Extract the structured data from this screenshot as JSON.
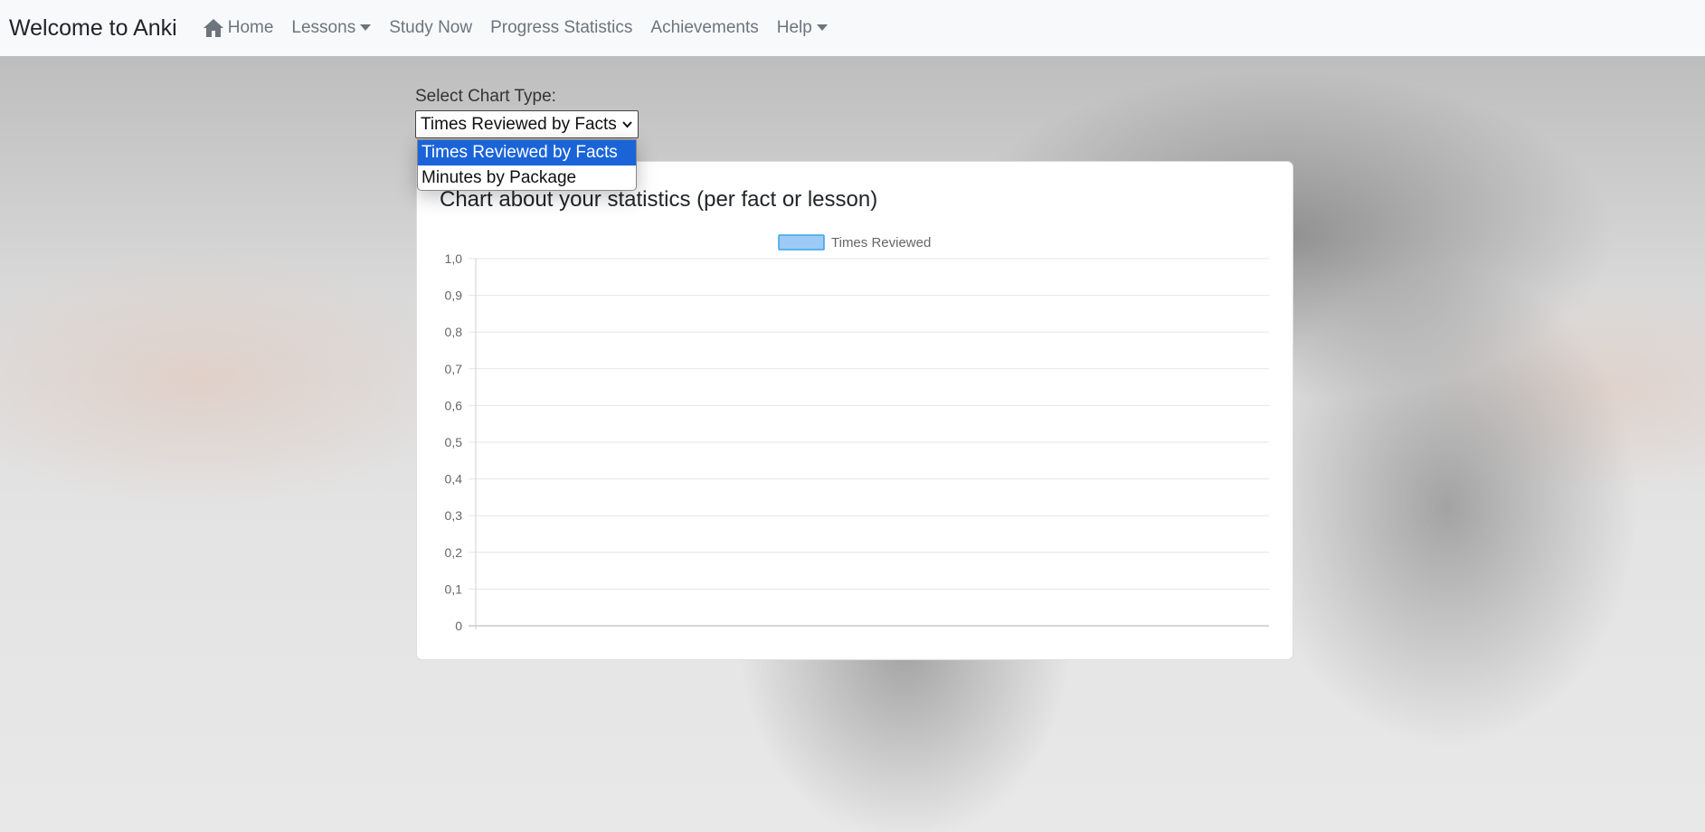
{
  "navbar": {
    "brand": "Welcome to Anki",
    "items": [
      {
        "label": "Home",
        "icon": "home-icon"
      },
      {
        "label": "Lessons",
        "dropdown": true
      },
      {
        "label": "Study Now"
      },
      {
        "label": "Progress Statistics"
      },
      {
        "label": "Achievements"
      },
      {
        "label": "Help",
        "dropdown": true
      }
    ]
  },
  "chart_select": {
    "label": "Select Chart Type:",
    "selected": "Times Reviewed by Facts",
    "options": [
      "Times Reviewed by Facts",
      "Minutes by Package"
    ],
    "highlight_color": "#1a64d8"
  },
  "card": {
    "title": "Chart about your statistics (per fact or lesson)"
  },
  "chart_data": {
    "type": "bar",
    "title": "",
    "categories": [],
    "series": [
      {
        "name": "Times Reviewed",
        "values": [],
        "color": "#9ecbf5",
        "border": "#36a2eb"
      }
    ],
    "ylim": [
      0,
      1
    ],
    "yticks": [
      "0",
      "0,1",
      "0,2",
      "0,3",
      "0,4",
      "0,5",
      "0,6",
      "0,7",
      "0,8",
      "0,9",
      "1,0"
    ],
    "grid": true,
    "legend": "top"
  }
}
